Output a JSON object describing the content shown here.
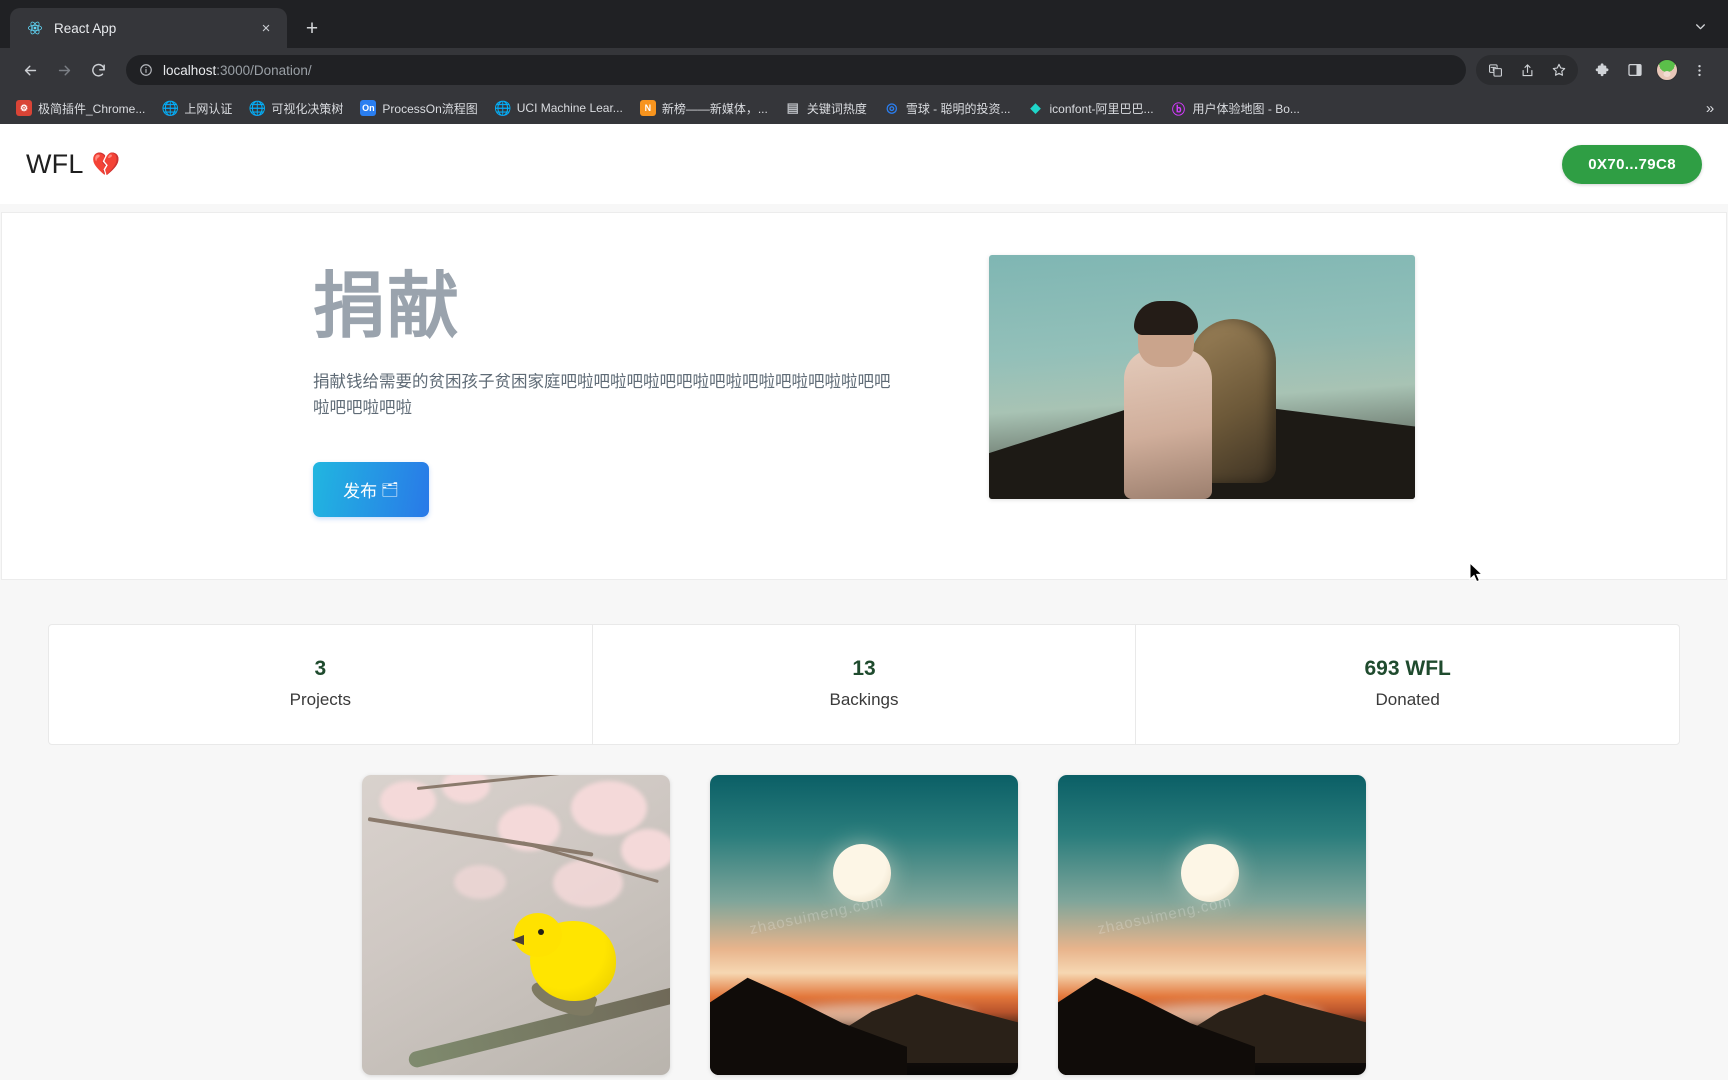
{
  "browser": {
    "tab": {
      "title": "React App",
      "favicon_icon": "react-atom-icon",
      "close_icon": "×"
    },
    "new_tab_label": "+",
    "tab_list_icon": "chevron-down-icon",
    "nav": {
      "back_icon": "←",
      "forward_icon": "→",
      "reload_icon": "⟳"
    },
    "omnibox": {
      "info_icon": "circle-info-icon",
      "host": "localhost",
      "path": ":3000/Donation/"
    },
    "toolbar_icons": [
      {
        "name": "translate-icon",
        "glyph": "文"
      },
      {
        "name": "share-icon",
        "glyph": "↥"
      },
      {
        "name": "bookmark-star-icon",
        "glyph": "☆"
      },
      {
        "name": "extensions-puzzle-icon",
        "glyph": "🧩"
      },
      {
        "name": "side-panel-icon",
        "glyph": "◧"
      },
      {
        "name": "profile-avatar",
        "glyph": ""
      },
      {
        "name": "chrome-menu-icon",
        "glyph": "⋮"
      }
    ],
    "bookmarks": [
      {
        "label": "极简插件_Chrome...",
        "icon": "extension-icon",
        "color": "#d94436"
      },
      {
        "label": "上网认证",
        "icon": "globe-icon",
        "color": "#8ab4f8"
      },
      {
        "label": "可视化决策树",
        "icon": "globe-icon",
        "color": "#8ab4f8"
      },
      {
        "label": "ProcessOn流程图",
        "icon": "processon-icon",
        "color": "#2a7ef0",
        "text": "On"
      },
      {
        "label": "UCI Machine Lear...",
        "icon": "globe-icon",
        "color": "#8ab4f8"
      },
      {
        "label": "新榜——新媒体，...",
        "icon": "newrank-icon",
        "color": "#f7941e"
      },
      {
        "label": "关键词热度",
        "icon": "folder-icon",
        "color": "#b6b9be"
      },
      {
        "label": "雪球 - 聪明的投资...",
        "icon": "xueqiu-icon",
        "color": "#2a7ef0"
      },
      {
        "label": "iconfont-阿里巴巴...",
        "icon": "iconfont-icon",
        "color": "#1fd6c9"
      },
      {
        "label": "用户体验地图 - Bo...",
        "icon": "boardmix-icon",
        "color": "#d43aff"
      }
    ],
    "bookmarks_overflow_icon": "»"
  },
  "page": {
    "header": {
      "brand_text": "WFL",
      "brand_mark": "💔",
      "wallet_address": "0X70...79C8"
    },
    "hero": {
      "title": "捐献",
      "description": "捐献钱给需要的贫困孩子贫困家庭吧啦吧啦吧啦吧吧啦吧啦吧啦吧啦吧啦啦吧吧啦吧吧啦吧啦",
      "button_label": "发布",
      "button_glyph": "🗂",
      "photo_alt": "child-with-basket-photo"
    },
    "stats": [
      {
        "value": "3",
        "label": "Projects"
      },
      {
        "value": "13",
        "label": "Backings"
      },
      {
        "value": "693 WFL",
        "label": "Donated"
      }
    ],
    "project_cards": [
      {
        "name": "project-card-bird",
        "alt": "yellow-bird-on-cherry-blossom"
      },
      {
        "name": "project-card-moon-1",
        "alt": "moon-over-mountains"
      },
      {
        "name": "project-card-moon-2",
        "alt": "moon-over-mountains"
      }
    ],
    "watermark_text": "zhaosuimeng.com"
  },
  "colors": {
    "wallet_green": "#2f9e44",
    "stat_value_green": "#1f4b2e",
    "hero_button_from": "#21b6e0",
    "hero_button_to": "#2979e8",
    "hero_title_gray": "#9aa3ad",
    "page_bg": "#f7f7f7"
  }
}
